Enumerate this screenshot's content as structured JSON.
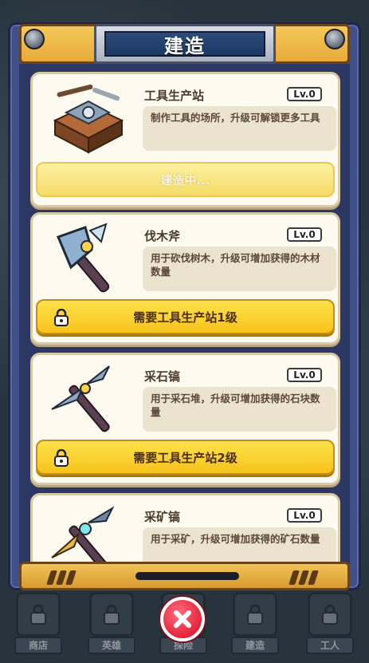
{
  "title": "建造",
  "cards": [
    {
      "name": "工具生产站",
      "level": "Lv.0",
      "description": "制作工具的场所，升级可解锁更多工具",
      "action_label": "建造中...",
      "icon": "workshop-icon"
    },
    {
      "name": "伐木斧",
      "level": "Lv.0",
      "description": "用于砍伐树木，升级可增加获得的木材数量",
      "action_label": "需要工具生产站1级",
      "icon": "axe-icon"
    },
    {
      "name": "采石镐",
      "level": "Lv.0",
      "description": "用于采石堆，升级可增加获得的石块数量",
      "action_label": "需要工具生产站2级",
      "icon": "stone-pickaxe-icon"
    },
    {
      "name": "采矿镐",
      "level": "Lv.0",
      "description": "用于采矿，升级可增加获得的矿石数量",
      "icon": "mining-pickaxe-icon"
    }
  ],
  "nav": [
    {
      "label": "商店",
      "icon": "lock-icon"
    },
    {
      "label": "英雄",
      "icon": "lock-icon"
    },
    {
      "label": "探险",
      "icon": "lock-icon"
    },
    {
      "label": "建造",
      "icon": "lock-icon"
    },
    {
      "label": "工人",
      "icon": "lock-icon"
    }
  ],
  "colors": {
    "frame": "#3f4f8a",
    "card": "#fffaf0",
    "button_yellow": "#f6c21c",
    "close_red": "#e3243d"
  }
}
